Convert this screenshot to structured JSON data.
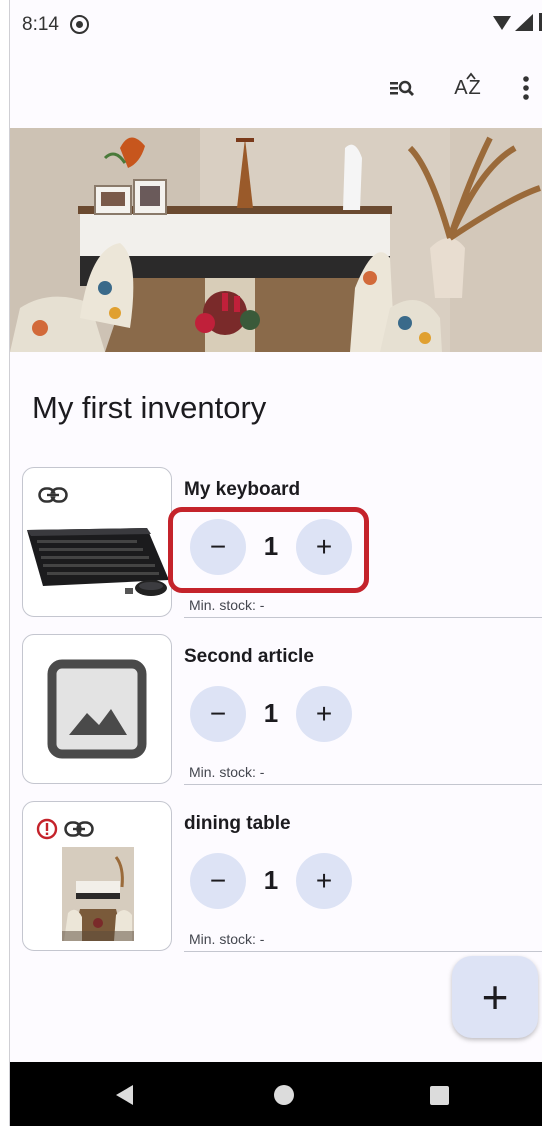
{
  "status_bar": {
    "time": "8:14"
  },
  "toolbar": {
    "filter_icon": "filter-search-icon",
    "sort_label": "AZ",
    "more_icon": "more-vert-icon"
  },
  "inventory": {
    "title": "My first inventory"
  },
  "items": [
    {
      "name": "My keyboard",
      "quantity": "1",
      "min_stock": "Min. stock: -",
      "minus": "−",
      "plus": "+",
      "icons": [
        "link-icon"
      ]
    },
    {
      "name": "Second article",
      "quantity": "1",
      "min_stock": "Min. stock: -",
      "minus": "−",
      "plus": "+",
      "icons": [
        "image-placeholder-icon"
      ]
    },
    {
      "name": "dining table",
      "quantity": "1",
      "min_stock": "Min. stock: -",
      "minus": "−",
      "plus": "+",
      "icons": [
        "alert-icon",
        "link-icon"
      ]
    }
  ],
  "fab": {
    "label": "+"
  },
  "colors": {
    "accent_container": "#dde3f5",
    "highlight": "#c4232b",
    "alert": "#c4232b"
  }
}
